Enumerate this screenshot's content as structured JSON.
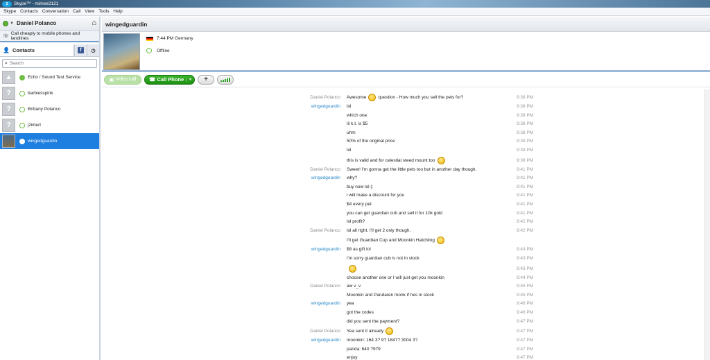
{
  "window": {
    "title": "Skype™ - mimee2121",
    "logo": "skype"
  },
  "menu": [
    "Skype",
    "Contacts",
    "Conversation",
    "Call",
    "View",
    "Tools",
    "Help"
  ],
  "profile": {
    "name": "Daniel Polanco",
    "status_color": "#5fb238"
  },
  "promo": {
    "text": "Call cheaply to mobile phones and landlines"
  },
  "contacts_tab": {
    "label": "Contacts"
  },
  "search": {
    "placeholder": "Search"
  },
  "contacts": [
    {
      "name": "Echo / Sound Test Service",
      "online": true,
      "avatar": ""
    },
    {
      "name": "barbiesspink",
      "online": false,
      "avatar": "?"
    },
    {
      "name": "Brittany Polanco",
      "online": false,
      "avatar": "?"
    },
    {
      "name": "jzimerl",
      "online": false,
      "avatar": "?"
    },
    {
      "name": "wingedguardin",
      "online": false,
      "avatar": "",
      "selected": true
    }
  ],
  "conversation": {
    "name": "wingedguardin",
    "local_time": "7:44 PM Germany",
    "status": "Offline"
  },
  "toolbar": {
    "video": "Video call",
    "call": "Call Phone",
    "plus": "+"
  },
  "messages": [
    {
      "sender": "Daniel Polanco",
      "side": "me",
      "text": "Awesome",
      "smiley": "mid",
      "after": "question - How much you sell the pets for?",
      "time": "9:38 PM"
    },
    {
      "sender": "wingedguardin",
      "side": "them",
      "text": "lol",
      "time": "9:38 PM"
    },
    {
      "sender": "",
      "side": "them",
      "text": "which one",
      "time": "9:38 PM"
    },
    {
      "sender": "",
      "side": "them",
      "text": "lil k.t. is $5",
      "time": "9:38 PM"
    },
    {
      "sender": "",
      "side": "them",
      "text": "uhm",
      "time": "9:38 PM"
    },
    {
      "sender": "",
      "side": "them",
      "text": "50% of the original price",
      "time": "9:39 PM"
    },
    {
      "sender": "",
      "side": "them",
      "text": "lol",
      "time": "9:39 PM"
    },
    {
      "sender": "",
      "side": "them",
      "text": "this is valid and for celestial steed mount  too",
      "smiley": "end",
      "time": "9:39 PM"
    },
    {
      "sender": "Daniel Polanco",
      "side": "me",
      "text": "Sweet! I'm gonna get the little pets too but in another day though.",
      "time": "9:41 PM"
    },
    {
      "sender": "wingedguardin",
      "side": "them",
      "text": "why?",
      "time": "9:41 PM"
    },
    {
      "sender": "",
      "side": "them",
      "text": "buy now lol (:",
      "time": "9:41 PM"
    },
    {
      "sender": "",
      "side": "them",
      "text": "i will make a discount for you",
      "time": "9:41 PM"
    },
    {
      "sender": "",
      "side": "them",
      "text": "$4 every pet",
      "time": "9:41 PM"
    },
    {
      "sender": "",
      "side": "them",
      "text": "you can get guardian cub and sell it for  10k gold",
      "time": "9:41 PM"
    },
    {
      "sender": "",
      "side": "them",
      "text": "lol profit?",
      "time": "9:42 PM"
    },
    {
      "sender": "Daniel Polanco",
      "side": "me",
      "text": "lol all right. I'll get 2 only though.",
      "time": "9:42 PM"
    },
    {
      "sender": "",
      "side": "me",
      "text": "I'll get Guardian Cup and Moonkin Hatchling",
      "smiley": "end",
      "time": ""
    },
    {
      "sender": "wingedguardin",
      "side": "them",
      "text": "$8 as gift lol",
      "time": "9:43 PM"
    },
    {
      "sender": "",
      "side": "them",
      "text": "i'm sorry guardian cub is not in stock",
      "time": "9:43 PM"
    },
    {
      "sender": "",
      "side": "them",
      "text": "",
      "smiley": "only",
      "time": "9:43 PM"
    },
    {
      "sender": "",
      "side": "them",
      "text": "choose another one or I will just get you moonkin",
      "time": "9:44 PM"
    },
    {
      "sender": "Daniel Polanco",
      "side": "me",
      "text": "aw v_v",
      "time": "9:45 PM"
    },
    {
      "sender": "",
      "side": "me",
      "text": "Moonkin and Pandaren monk if hes in stock",
      "time": "9:45 PM"
    },
    {
      "sender": "wingedguardin",
      "side": "them",
      "text": "yea",
      "time": "9:46 PM"
    },
    {
      "sender": "",
      "side": "them",
      "text": "got the codes",
      "time": "9:46 PM"
    },
    {
      "sender": "",
      "side": "them",
      "text": "did you sent the payment?",
      "time": "9:47 PM"
    },
    {
      "sender": "Daniel Polanco",
      "side": "me",
      "text": "Yea sent it already",
      "smiley": "end",
      "time": "9:47 PM"
    },
    {
      "sender": "wingedguardin",
      "side": "them",
      "text": "moonkin: 164  3?  9?  1847?  3004  3?",
      "time": "9:47 PM"
    },
    {
      "sender": "",
      "side": "them",
      "text": "panda: 640  ?979",
      "time": "9:47 PM"
    },
    {
      "sender": "",
      "side": "them",
      "text": "enjoy",
      "time": "9:47 PM"
    }
  ]
}
